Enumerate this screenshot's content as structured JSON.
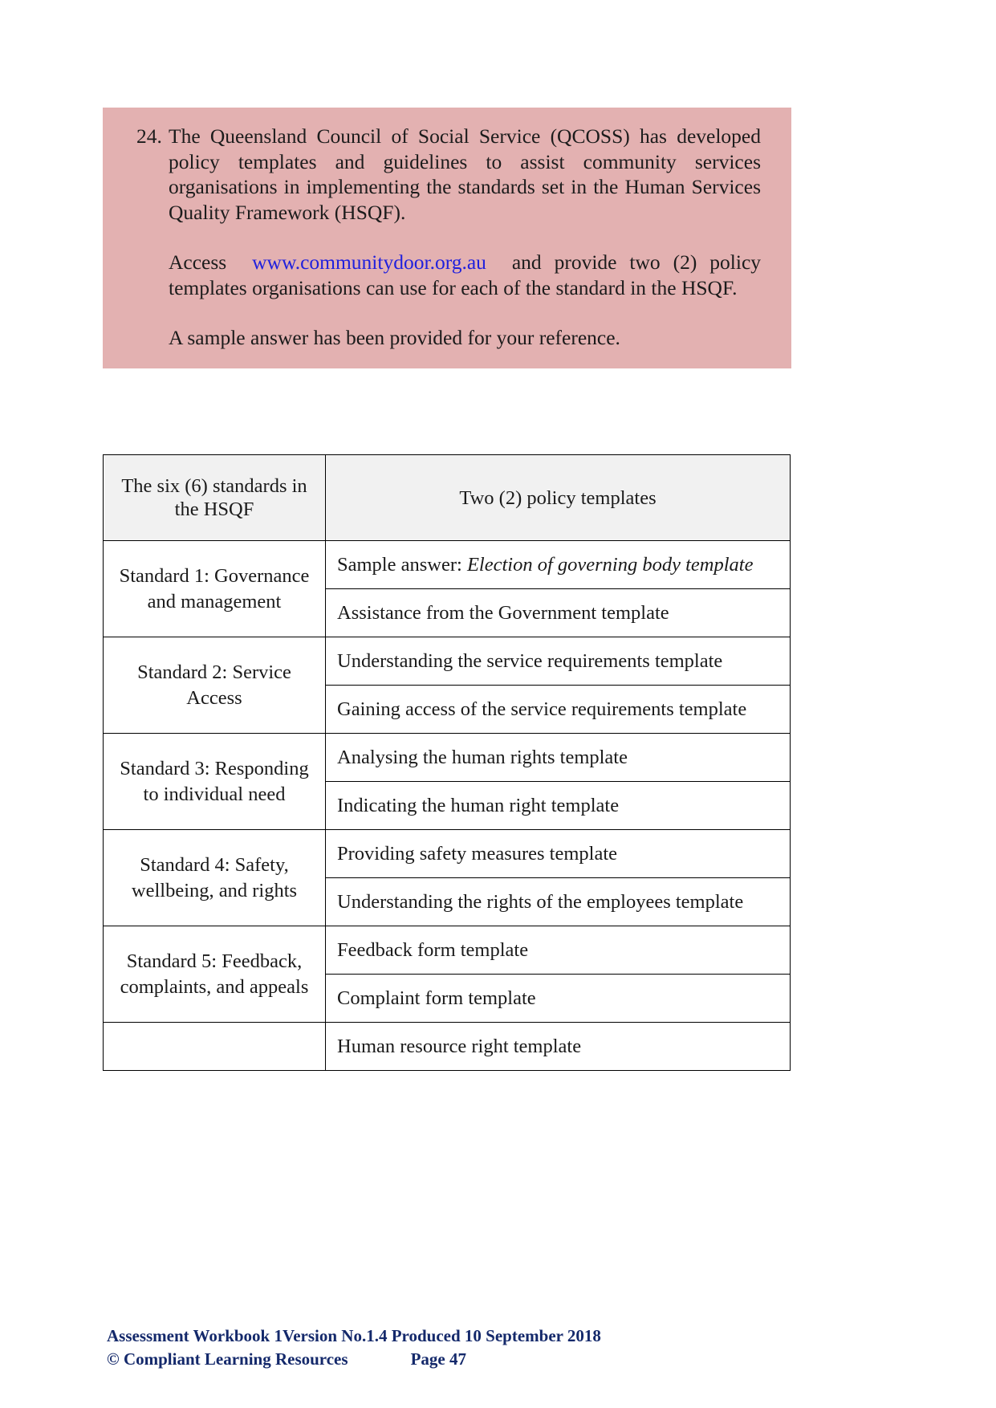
{
  "question": {
    "number": "24.",
    "paragraph1": "The Queensland Council of Social Service (QCOSS) has developed policy templates and guidelines to assist community services organisations in implementing the standards set in the Human Services Quality Framework (HSQF).",
    "paragraph2_before_link": "Access",
    "link_text": "www.communitydoor.org.au",
    "paragraph2_after_link": "and provide two (2) policy templates organisations can use for each of the standard in the HSQF.",
    "paragraph3": "A sample answer has been provided for your reference.",
    "box_color": "#e3b1b1",
    "link_color": "#2020dd"
  },
  "table": {
    "headers": {
      "col1": "The six (6) standards in the HSQF",
      "col2": "Two (2) policy templates"
    },
    "header_background": "#f1f1f1",
    "sample_answer_color": "#2e6093",
    "rows": [
      {
        "standard": "Standard 1: Governance and management",
        "rowspan": 2,
        "templates": [
          {
            "is_sample": true,
            "prefix": "Sample answer: ",
            "text": "Election of governing body template"
          },
          {
            "is_sample": false,
            "text": "Assistance from the Government template"
          }
        ]
      },
      {
        "standard": "Standard 2: Service Access",
        "rowspan": 2,
        "templates": [
          {
            "is_sample": false,
            "text": "Understanding the service requirements template"
          },
          {
            "is_sample": false,
            "text": "Gaining access of the service requirements template"
          }
        ]
      },
      {
        "standard": "Standard 3: Responding to individual need",
        "rowspan": 2,
        "templates": [
          {
            "is_sample": false,
            "text": "Analysing the human rights template"
          },
          {
            "is_sample": false,
            "text": "Indicating the human right template"
          }
        ]
      },
      {
        "standard": "Standard 4: Safety, wellbeing, and rights",
        "rowspan": 2,
        "templates": [
          {
            "is_sample": false,
            "text": "Providing safety measures template"
          },
          {
            "is_sample": false,
            "text": "Understanding the rights of the employees template"
          }
        ]
      },
      {
        "standard": "Standard 5: Feedback, complaints, and appeals",
        "rowspan": 2,
        "templates": [
          {
            "is_sample": false,
            "text": "Feedback form template"
          },
          {
            "is_sample": false,
            "text": "Complaint form template"
          }
        ]
      },
      {
        "standard": "",
        "rowspan": 1,
        "templates": [
          {
            "is_sample": false,
            "text": "Human resource right template"
          }
        ]
      }
    ]
  },
  "footer": {
    "line1": "Assessment Workbook 1Version No.1.4 Produced 10 September 2018",
    "copyright": "© Compliant Learning Resources",
    "page": "Page 47",
    "color": "#14296b"
  }
}
